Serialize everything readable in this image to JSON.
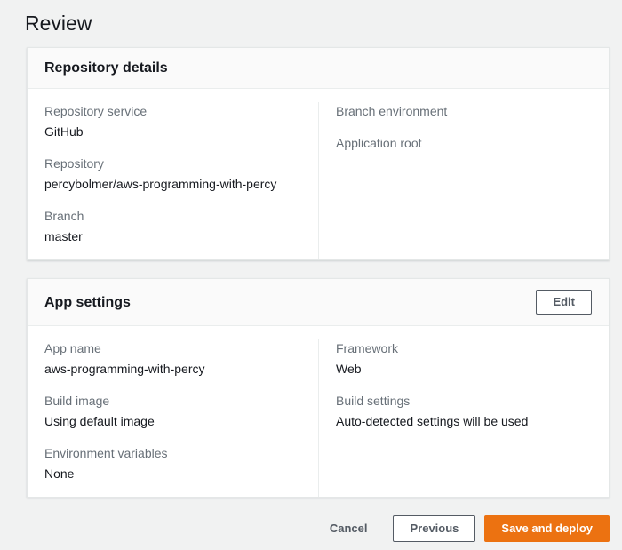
{
  "page": {
    "title": "Review"
  },
  "colors": {
    "page_background": "#f1f2f2",
    "card_background": "#ffffff",
    "card_header_background": "#fafafa",
    "divider": "#eaeded",
    "label_text": "#687078",
    "value_text": "#16191f",
    "button_border": "#545b64",
    "primary_accent": "#ec7211",
    "primary_text": "#ffffff"
  },
  "cards": [
    {
      "title": "Repository details",
      "columns": [
        {
          "fields": [
            {
              "label": "Repository service",
              "value": "GitHub"
            },
            {
              "label": "Repository",
              "value": "percybolmer/aws-programming-with-percy"
            },
            {
              "label": "Branch",
              "value": "master"
            }
          ]
        },
        {
          "fields": [
            {
              "label": "Branch environment",
              "value": ""
            },
            {
              "label": "Application root",
              "value": ""
            }
          ]
        }
      ]
    },
    {
      "title": "App settings",
      "edit_label": "Edit",
      "columns": [
        {
          "fields": [
            {
              "label": "App name",
              "value": "aws-programming-with-percy"
            },
            {
              "label": "Build image",
              "value": "Using default image"
            },
            {
              "label": "Environment variables",
              "value": "None"
            }
          ]
        },
        {
          "fields": [
            {
              "label": "Framework",
              "value": "Web"
            },
            {
              "label": "Build settings",
              "value": "Auto-detected settings will be used"
            }
          ]
        }
      ]
    }
  ],
  "footer": {
    "cancel_label": "Cancel",
    "previous_label": "Previous",
    "save_label": "Save and deploy"
  }
}
